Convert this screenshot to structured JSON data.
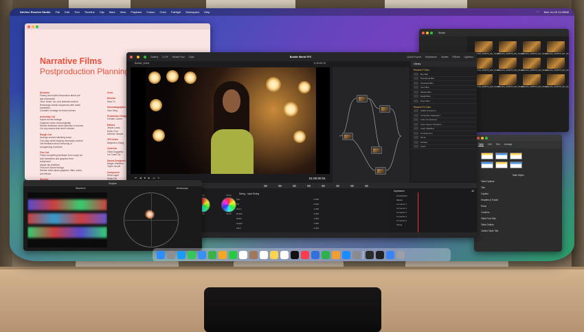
{
  "menubar": {
    "app": "DaVinci Resolve Studio",
    "items": [
      "File",
      "Edit",
      "Trim",
      "Timeline",
      "Clip",
      "Mark",
      "View",
      "Playback",
      "Fusion",
      "Color",
      "Fairlight",
      "Workspace",
      "Help"
    ],
    "clock": "Mon Jul 15 11:05AM"
  },
  "document": {
    "title": "Narrative Films",
    "subtitle": "Postproduction Planning",
    "sections_left": [
      {
        "head": "Direction",
        "lines": [
          "Pacing and rhythm discussion about pre",
          "last review/edit",
          "Tone: tense, fun, and dramatic scenes",
          "Rearrange certain sequences with audio",
          "transitions",
          "Consider montage for travel scenes"
        ]
      },
      {
        "head": "Assembly Cut",
        "lines": [
          "Import all raw footage",
          "Organize shots chronologically",
          "Review feedback about selection of scenes",
          "Cut any scenes that aren't needed"
        ]
      },
      {
        "head": "Rough Cut",
        "lines": [
          "Arrange scenes following script",
          "Trim clips while keeping necessary content",
          "Get feedback about removing or",
          "reorganizing moments"
        ]
      },
      {
        "head": "Fine Cut",
        "lines": [
          "Finish completing feedback from rough cut",
          "Add transitions and graphics from",
          "storyboard",
          "Adjust clip positions",
          "Fine-tune scene timings",
          "Review notes about graphics, titles, audio,",
          "and effects"
        ]
      },
      {
        "head": "Director",
        "lines": []
      }
    ],
    "sections_right": [
      {
        "head": "Crew",
        "lines": []
      },
      {
        "head": "Director",
        "lines": [
          "Sara Tu"
        ]
      },
      {
        "head": "Cinematographer",
        "lines": [
          "Xiao Yang"
        ]
      },
      {
        "head": "Production Designer",
        "lines": [
          "Cristian Castro"
        ]
      },
      {
        "head": "Editors",
        "lines": [
          "Jessie Lewis",
          "Keiko Cruz",
          "Michele Yasuda"
        ]
      },
      {
        "head": "VFX Artist",
        "lines": [
          "Alejandra Zhang"
        ]
      },
      {
        "head": "Colorists",
        "lines": [
          "Olivia Duggleby",
          "Lei Coast Yip"
        ]
      },
      {
        "head": "Sound Designers",
        "lines": [
          "Megan Martinez",
          "Taylor Jacobi"
        ]
      },
      {
        "head": "Composers",
        "lines": [
          "Seira Lager",
          "Stella Gill"
        ]
      }
    ]
  },
  "finder": {
    "title": "Shots",
    "files": [
      "H0013205_3459575_A01_01.mov",
      "H0012201_3495578_A01_02.mov",
      "H0012201_3495578_A01_03.mov",
      "H0012201_3495578_A01_04.mov",
      "H0013205_3459575_A02_01.mov",
      "H0012201_3495578_A02_02.mov",
      "H0012201_3495578_A02_03.mov",
      "H0012201_3495578_A02_04.mov",
      "H0013205_3459575_A03_01.mov",
      "H0012201_3495578_A03_02.mov",
      "H0012201_3495578_A03_03.mov",
      "H0012201_3495578_A03_04.mov"
    ]
  },
  "numbers": {
    "tabs": [
      "Table",
      "Cell",
      "Text",
      "Arrange"
    ],
    "panel_title": "Table Styles",
    "options": [
      "Table Options",
      "Title",
      "Caption",
      "Headers & Footer",
      "Rows",
      "Columns",
      "Table Font Size",
      "Table Outline",
      "Outline Table Title"
    ]
  },
  "resolve": {
    "title": "Bubble World VFX",
    "clip_name": "Bubble_World",
    "tabs": [
      "Gallery",
      "LUTs",
      "Media Pool",
      "Clips"
    ],
    "right_tabs": [
      "Quick Export",
      "Keyframes",
      "Nodes",
      "Effects",
      "Lightbox"
    ],
    "timecode_top": "11:53:50:18",
    "timecode": "01:00:00:01",
    "fx_panel": {
      "title": "Library",
      "sections": [
        {
          "name": "Resolve FX Blur",
          "items": [
            "Box Blur",
            "Directional Blur",
            "Gaussian Blur",
            "Lens Blur",
            "Mosaic Blur",
            "Radial Blur",
            "Zoom Blur"
          ]
        },
        {
          "name": "Resolve FX Color",
          "items": [
            "ACES Transform",
            "Chromatic Adaptation",
            "Color Compressor",
            "Color Space Transform",
            "Color Stabilizer",
            "Contrast Pop",
            "DCTL",
            "Dehaze",
            "Invert"
          ]
        }
      ]
    },
    "color_panel": {
      "wheels": [
        "Gain",
        "Offset"
      ],
      "wheel_values": [
        "1.00",
        "25.00"
      ],
      "section": "Sizing - Input Sizing",
      "params": [
        {
          "label": "Pan",
          "value": "0.000"
        },
        {
          "label": "Tilt",
          "value": "0.000"
        },
        {
          "label": "Zoom",
          "value": "1.000"
        },
        {
          "label": "Rotate",
          "value": "0.000"
        },
        {
          "label": "Width",
          "value": "1.000"
        },
        {
          "label": "Height",
          "value": "1.000"
        },
        {
          "label": "Pitch",
          "value": "0.000"
        },
        {
          "label": "Yaw",
          "value": "0.000"
        }
      ],
      "keyframes": {
        "title": "Keyframes",
        "filter": "All",
        "timecode": "01:00:00:01",
        "tracks": [
          "Master",
          "Corrector 1",
          "Corrector 2",
          "Corrector 3",
          "Corrector 4",
          "Corrector 5",
          "Sizing"
        ]
      }
    }
  },
  "scopes": {
    "title": "Scopes",
    "left_label": "Waveform",
    "right_label": "Vectorscope"
  },
  "dock": {
    "icons": [
      "finder-icon",
      "launchpad-icon",
      "safari-icon",
      "messages-icon",
      "mail-icon",
      "maps-icon",
      "photos-icon",
      "facetime-icon",
      "calendar-icon",
      "contacts-icon",
      "reminders-icon",
      "notes-icon",
      "freeform-icon",
      "tv-icon",
      "music-icon",
      "keynote-icon",
      "numbers-icon",
      "pages-icon",
      "app-store-icon",
      "system-settings-icon",
      "davinci-resolve-icon",
      "terminal-icon",
      "downloads-icon",
      "trash-icon"
    ],
    "colors": [
      "#2d8cff",
      "#8e8e93",
      "#1b9af7",
      "#34c759",
      "#3a8ef6",
      "#37b34a",
      "#f5a623",
      "#28c840",
      "#ffffff",
      "#a3785a",
      "#ffffff",
      "#fcd34d",
      "#ffffff",
      "#111111",
      "#fa3c4f",
      "#2f6fe0",
      "#2bb24c",
      "#f29f30",
      "#1a8cff",
      "#8a8a8f",
      "#2b2b2b",
      "#222222",
      "#3b82f6",
      "#9aa0a6"
    ]
  }
}
